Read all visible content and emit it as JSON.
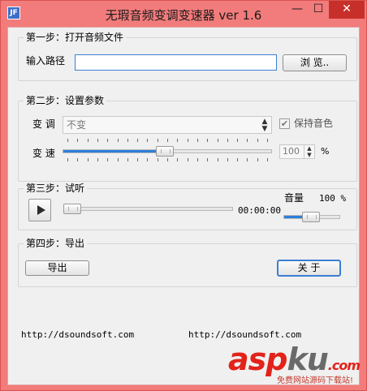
{
  "window": {
    "title": "无瑕音频变调变速器 ver 1.6",
    "icon_text": "JF",
    "minimize_glyph": "—",
    "maximize_glyph": "☐",
    "close_glyph": "✕"
  },
  "step1": {
    "legend": "第一步：打开音频文件",
    "path_label": "输入路径",
    "path_value": "",
    "browse_label": "浏  览.."
  },
  "step2": {
    "legend": "第二步：设置参数",
    "pitch_label": "变 调",
    "pitch_value": "不变",
    "keep_pitch_label": "保持音色",
    "keep_pitch_checked": true,
    "check_glyph": "✔",
    "speed_label": "变 速",
    "speed_slider_fraction": 0.49,
    "speed_value": "100",
    "speed_unit": "%"
  },
  "step3": {
    "legend": "第三步：试听",
    "time": "00:00:00",
    "progress_fraction": 0.0,
    "volume_label": "音量",
    "volume_value": "100 %",
    "volume_fraction": 0.5
  },
  "step4": {
    "legend": "第四步：导出",
    "export_label": "导出",
    "close_label": "关  于"
  },
  "footer": {
    "link_left": "http://dsoundsoft.com",
    "link_right": "http://dsoundsoft.com"
  },
  "watermark": {
    "main_red": "asp",
    "main_gray": "ku",
    "main_tail": ".com",
    "sub": "免费网站源码下载站!"
  },
  "colors": {
    "title_bar": "#f27b7b",
    "accent": "#2e7fd9",
    "close_button": "#c7302a"
  }
}
